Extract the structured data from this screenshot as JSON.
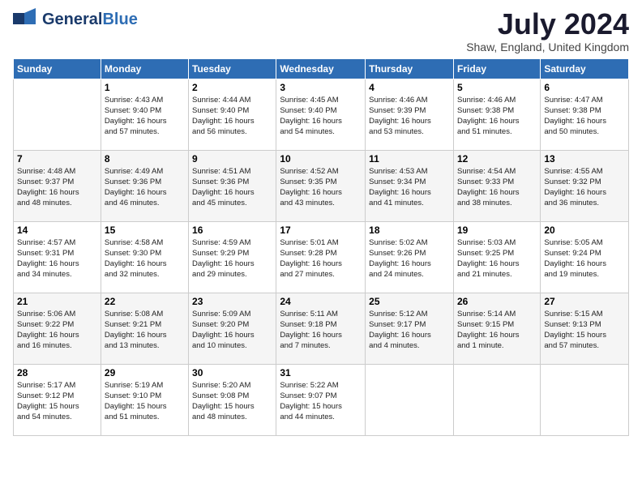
{
  "header": {
    "logo_general": "General",
    "logo_blue": "Blue",
    "title": "July 2024",
    "location": "Shaw, England, United Kingdom"
  },
  "days_of_week": [
    "Sunday",
    "Monday",
    "Tuesday",
    "Wednesday",
    "Thursday",
    "Friday",
    "Saturday"
  ],
  "weeks": [
    [
      {
        "day": "",
        "info": ""
      },
      {
        "day": "1",
        "info": "Sunrise: 4:43 AM\nSunset: 9:40 PM\nDaylight: 16 hours\nand 57 minutes."
      },
      {
        "day": "2",
        "info": "Sunrise: 4:44 AM\nSunset: 9:40 PM\nDaylight: 16 hours\nand 56 minutes."
      },
      {
        "day": "3",
        "info": "Sunrise: 4:45 AM\nSunset: 9:40 PM\nDaylight: 16 hours\nand 54 minutes."
      },
      {
        "day": "4",
        "info": "Sunrise: 4:46 AM\nSunset: 9:39 PM\nDaylight: 16 hours\nand 53 minutes."
      },
      {
        "day": "5",
        "info": "Sunrise: 4:46 AM\nSunset: 9:38 PM\nDaylight: 16 hours\nand 51 minutes."
      },
      {
        "day": "6",
        "info": "Sunrise: 4:47 AM\nSunset: 9:38 PM\nDaylight: 16 hours\nand 50 minutes."
      }
    ],
    [
      {
        "day": "7",
        "info": "Sunrise: 4:48 AM\nSunset: 9:37 PM\nDaylight: 16 hours\nand 48 minutes."
      },
      {
        "day": "8",
        "info": "Sunrise: 4:49 AM\nSunset: 9:36 PM\nDaylight: 16 hours\nand 46 minutes."
      },
      {
        "day": "9",
        "info": "Sunrise: 4:51 AM\nSunset: 9:36 PM\nDaylight: 16 hours\nand 45 minutes."
      },
      {
        "day": "10",
        "info": "Sunrise: 4:52 AM\nSunset: 9:35 PM\nDaylight: 16 hours\nand 43 minutes."
      },
      {
        "day": "11",
        "info": "Sunrise: 4:53 AM\nSunset: 9:34 PM\nDaylight: 16 hours\nand 41 minutes."
      },
      {
        "day": "12",
        "info": "Sunrise: 4:54 AM\nSunset: 9:33 PM\nDaylight: 16 hours\nand 38 minutes."
      },
      {
        "day": "13",
        "info": "Sunrise: 4:55 AM\nSunset: 9:32 PM\nDaylight: 16 hours\nand 36 minutes."
      }
    ],
    [
      {
        "day": "14",
        "info": "Sunrise: 4:57 AM\nSunset: 9:31 PM\nDaylight: 16 hours\nand 34 minutes."
      },
      {
        "day": "15",
        "info": "Sunrise: 4:58 AM\nSunset: 9:30 PM\nDaylight: 16 hours\nand 32 minutes."
      },
      {
        "day": "16",
        "info": "Sunrise: 4:59 AM\nSunset: 9:29 PM\nDaylight: 16 hours\nand 29 minutes."
      },
      {
        "day": "17",
        "info": "Sunrise: 5:01 AM\nSunset: 9:28 PM\nDaylight: 16 hours\nand 27 minutes."
      },
      {
        "day": "18",
        "info": "Sunrise: 5:02 AM\nSunset: 9:26 PM\nDaylight: 16 hours\nand 24 minutes."
      },
      {
        "day": "19",
        "info": "Sunrise: 5:03 AM\nSunset: 9:25 PM\nDaylight: 16 hours\nand 21 minutes."
      },
      {
        "day": "20",
        "info": "Sunrise: 5:05 AM\nSunset: 9:24 PM\nDaylight: 16 hours\nand 19 minutes."
      }
    ],
    [
      {
        "day": "21",
        "info": "Sunrise: 5:06 AM\nSunset: 9:22 PM\nDaylight: 16 hours\nand 16 minutes."
      },
      {
        "day": "22",
        "info": "Sunrise: 5:08 AM\nSunset: 9:21 PM\nDaylight: 16 hours\nand 13 minutes."
      },
      {
        "day": "23",
        "info": "Sunrise: 5:09 AM\nSunset: 9:20 PM\nDaylight: 16 hours\nand 10 minutes."
      },
      {
        "day": "24",
        "info": "Sunrise: 5:11 AM\nSunset: 9:18 PM\nDaylight: 16 hours\nand 7 minutes."
      },
      {
        "day": "25",
        "info": "Sunrise: 5:12 AM\nSunset: 9:17 PM\nDaylight: 16 hours\nand 4 minutes."
      },
      {
        "day": "26",
        "info": "Sunrise: 5:14 AM\nSunset: 9:15 PM\nDaylight: 16 hours\nand 1 minute."
      },
      {
        "day": "27",
        "info": "Sunrise: 5:15 AM\nSunset: 9:13 PM\nDaylight: 15 hours\nand 57 minutes."
      }
    ],
    [
      {
        "day": "28",
        "info": "Sunrise: 5:17 AM\nSunset: 9:12 PM\nDaylight: 15 hours\nand 54 minutes."
      },
      {
        "day": "29",
        "info": "Sunrise: 5:19 AM\nSunset: 9:10 PM\nDaylight: 15 hours\nand 51 minutes."
      },
      {
        "day": "30",
        "info": "Sunrise: 5:20 AM\nSunset: 9:08 PM\nDaylight: 15 hours\nand 48 minutes."
      },
      {
        "day": "31",
        "info": "Sunrise: 5:22 AM\nSunset: 9:07 PM\nDaylight: 15 hours\nand 44 minutes."
      },
      {
        "day": "",
        "info": ""
      },
      {
        "day": "",
        "info": ""
      },
      {
        "day": "",
        "info": ""
      }
    ]
  ]
}
